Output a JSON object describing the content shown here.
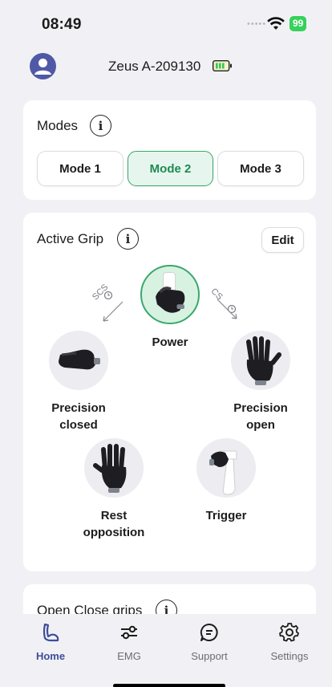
{
  "status_bar": {
    "time": "08:49",
    "battery": "99"
  },
  "header": {
    "device_name": "Zeus A-209130"
  },
  "modes": {
    "title": "Modes",
    "buttons": [
      {
        "label": "Mode 1",
        "active": false
      },
      {
        "label": "Mode 2",
        "active": true
      },
      {
        "label": "Mode 3",
        "active": false
      }
    ]
  },
  "active_grip": {
    "title": "Active Grip",
    "edit_label": "Edit",
    "left_transition": "SCS",
    "right_transition": "CS",
    "grips": [
      {
        "label": "Power",
        "selected": true,
        "icon": "power-grip-icon"
      },
      {
        "label": "Precision closed",
        "selected": false,
        "icon": "precision-closed-grip-icon"
      },
      {
        "label": "Precision open",
        "selected": false,
        "icon": "precision-open-grip-icon"
      },
      {
        "label": "Rest opposition",
        "selected": false,
        "icon": "rest-opposition-grip-icon"
      },
      {
        "label": "Trigger",
        "selected": false,
        "icon": "trigger-grip-icon"
      }
    ]
  },
  "open_close": {
    "title": "Open Close grips"
  },
  "tabs": [
    {
      "label": "Home",
      "icon": "arm-icon",
      "active": true
    },
    {
      "label": "EMG",
      "icon": "sliders-icon",
      "active": false
    },
    {
      "label": "Support",
      "icon": "chat-icon",
      "active": false
    },
    {
      "label": "Settings",
      "icon": "gear-icon",
      "active": false
    }
  ],
  "colors": {
    "accent_green": "#3aa76d",
    "accent_blue": "#3f4c9b",
    "background": "#f1f1f5"
  }
}
